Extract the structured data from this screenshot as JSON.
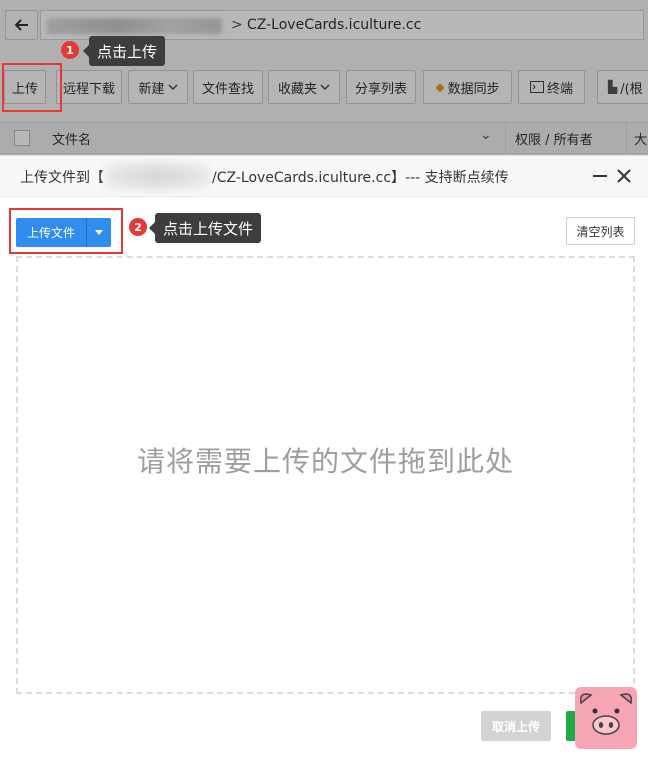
{
  "pathbar": {
    "back_icon": "arrow-left-icon",
    "path_separator": ">",
    "path_tail": "CZ-LoveCards.iculture.cc"
  },
  "toolbar": {
    "upload": "上传",
    "remote_download": "远程下载",
    "new": "新建",
    "file_search": "文件查找",
    "favorites": "收藏夹",
    "share_list": "分享列表",
    "data_sync": "数据同步",
    "terminal": "终端",
    "root": "/(根"
  },
  "list_header": {
    "name": "文件名",
    "perm_owner": "权限 / 所有者",
    "size": "大"
  },
  "callouts": [
    {
      "number": "1",
      "text": "点击上传"
    },
    {
      "number": "2",
      "text": "点击上传文件"
    }
  ],
  "dialog": {
    "title_prefix": "上传文件到【",
    "title_suffix": "/CZ-LoveCards.iculture.cc】--- 支持断点续传",
    "minimize_icon": "minimize-icon",
    "close_icon": "close-icon",
    "upload_button": "上传文件",
    "clear_button": "清空列表",
    "drop_text": "请将需要上传的文件拖到此处",
    "cancel_button": "取消上传"
  },
  "colors": {
    "accent_blue": "#2f8ded",
    "callout_red": "#e53935",
    "start_green": "#22a844",
    "pig_pink": "#f6a5b4"
  }
}
